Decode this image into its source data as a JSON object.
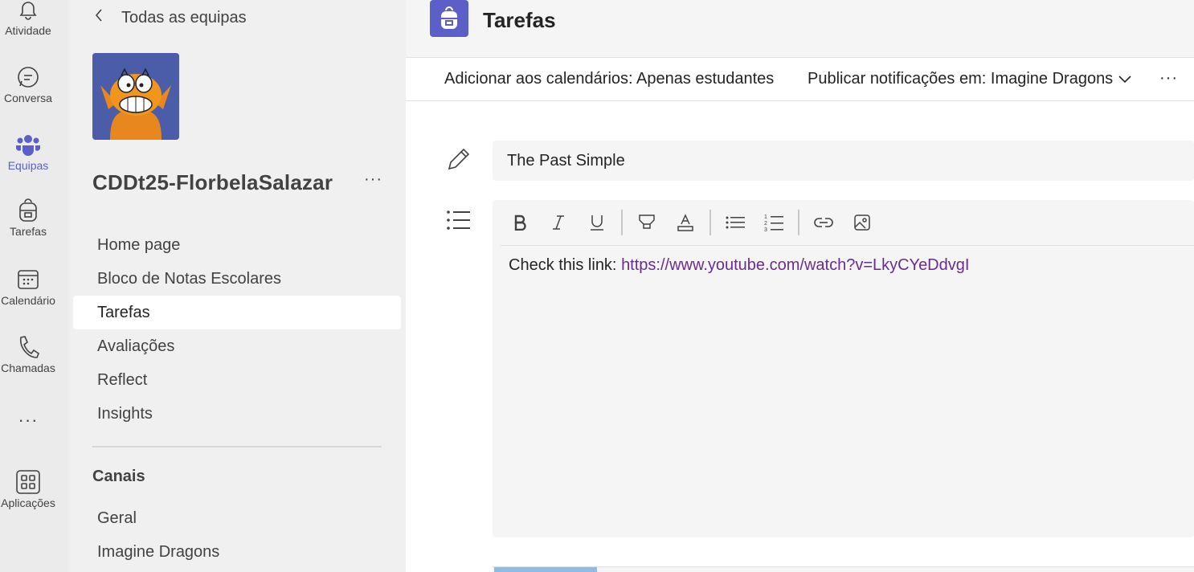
{
  "rail": {
    "items": [
      {
        "label": "Atividade",
        "icon": "bell-icon"
      },
      {
        "label": "Conversa",
        "icon": "chat-icon"
      },
      {
        "label": "Equipas",
        "icon": "teams-icon",
        "active": true
      },
      {
        "label": "Tarefas",
        "icon": "backpack-icon"
      },
      {
        "label": "Calendário",
        "icon": "calendar-icon"
      },
      {
        "label": "Chamadas",
        "icon": "phone-icon"
      },
      {
        "label": "Aplicações",
        "icon": "apps-icon"
      }
    ],
    "more_label": "···"
  },
  "panel": {
    "back_label": "Todas as equipas",
    "team_name": "CDDt25-FlorbelaSalazar",
    "team_more": "···",
    "nav": [
      {
        "label": "Home page"
      },
      {
        "label": "Bloco de Notas Escolares"
      },
      {
        "label": "Tarefas",
        "active": true
      },
      {
        "label": "Avaliações"
      },
      {
        "label": "Reflect"
      },
      {
        "label": "Insights"
      }
    ],
    "channels_title": "Canais",
    "channels": [
      {
        "label": "Geral"
      },
      {
        "label": "Imagine Dragons"
      }
    ]
  },
  "main": {
    "app_title": "Tarefas",
    "calendar_setting": "Adicionar aos calendários: Apenas estudantes",
    "publish_setting": "Publicar notificações em: Imagine Dragons",
    "more": "···",
    "assignment_title": "The Past Simple",
    "instructions_prefix": "Check this link: ",
    "instructions_link": "https://www.youtube.com/watch?v=LkyCYeDdvgI"
  },
  "colors": {
    "accent": "#5b5fc7",
    "link": "#6b2c91"
  }
}
